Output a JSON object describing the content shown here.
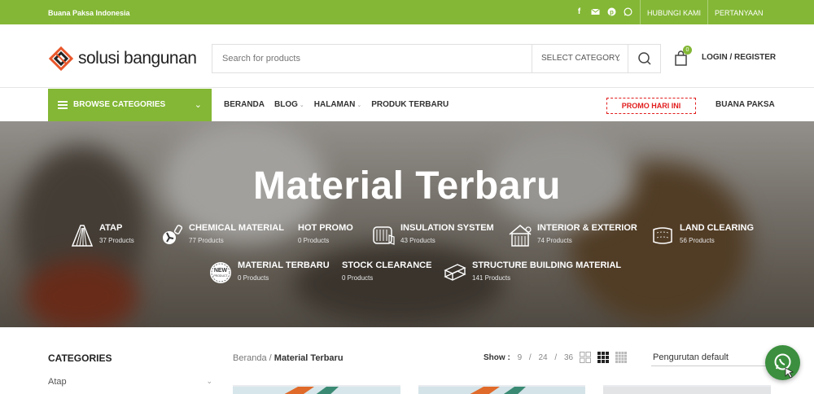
{
  "topbar": {
    "store_name": "Buana Paksa Indonesia",
    "social_icons": [
      "facebook-icon",
      "mail-icon",
      "pinterest-icon",
      "whatsapp-icon"
    ],
    "links": [
      "HUBUNGI KAMI",
      "PERTANYAAN"
    ]
  },
  "header": {
    "logo_text": "solusi bangunan",
    "search_placeholder": "Search for products",
    "category_select": "SELECT CATEGORY",
    "cart_count": "0",
    "login_label": "LOGIN / REGISTER"
  },
  "nav": {
    "browse_label": "BROWSE CATEGORIES",
    "menu": [
      {
        "label": "BERANDA",
        "dropdown": false
      },
      {
        "label": "BLOG",
        "dropdown": true
      },
      {
        "label": "HALAMAN",
        "dropdown": true
      },
      {
        "label": "PRODUK TERBARU",
        "dropdown": false
      }
    ],
    "promo_label": "PROMO HARI INI",
    "brand_label": "BUANA PAKSA"
  },
  "hero": {
    "title": "Material Terbaru",
    "categories": [
      {
        "name": "ATAP",
        "count": "37 Products",
        "icon": "roof-icon"
      },
      {
        "name": "CHEMICAL MATERIAL",
        "count": "77 Products",
        "icon": "chemical-icon"
      },
      {
        "name": "HOT PROMO",
        "count": "0 Products",
        "icon": ""
      },
      {
        "name": "INSULATION SYSTEM",
        "count": "43 Products",
        "icon": "insulation-icon"
      },
      {
        "name": "INTERIOR & EXTERIOR",
        "count": "74 Products",
        "icon": "building-icon"
      },
      {
        "name": "LAND CLEARING",
        "count": "56 Products",
        "icon": "land-icon"
      },
      {
        "name": "MATERIAL TERBARU",
        "count": "0 Products",
        "icon": "new-badge-icon"
      },
      {
        "name": "STOCK CLEARANCE",
        "count": "0 Products",
        "icon": ""
      },
      {
        "name": "STRUCTURE BUILDING MATERIAL",
        "count": "141 Products",
        "icon": "steel-beam-icon"
      }
    ]
  },
  "content": {
    "sidebar_title": "CATEGORIES",
    "sidebar_items": [
      "Atap"
    ],
    "breadcrumb_home": "Beranda",
    "breadcrumb_sep": "/",
    "breadcrumb_current": "Material Terbaru",
    "show_label": "Show :",
    "show_options": [
      "9",
      "/",
      "24",
      "/",
      "36"
    ],
    "sort_label": "Pengurutan default"
  },
  "colors": {
    "brand_green": "#83b735",
    "promo_red": "#e21d1d",
    "whatsapp_green": "#3b8f3e"
  }
}
